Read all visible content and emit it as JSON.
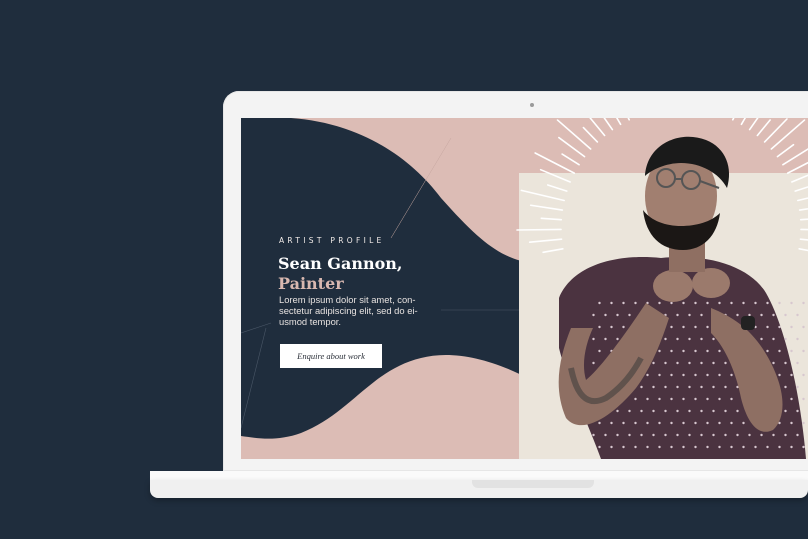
{
  "page": {
    "background_color": "#1f2d3d"
  },
  "hero": {
    "eyebrow": "ARTIST PROFILE",
    "name_line": "Sean Gannon,",
    "role_line": "Painter",
    "description": "Lorem ipsum dolor sit amet, con-sectetur adipiscing elit, sed do ei-usmod tempor.",
    "cta_label": "Enquire about work",
    "colors": {
      "navy": "#1f2d3d",
      "blush": "#dcbcb5",
      "cream": "#ebe5db",
      "accent_text": "#d8b8b0"
    }
  },
  "portrait": {
    "image_semantic": "portrait-photo"
  }
}
